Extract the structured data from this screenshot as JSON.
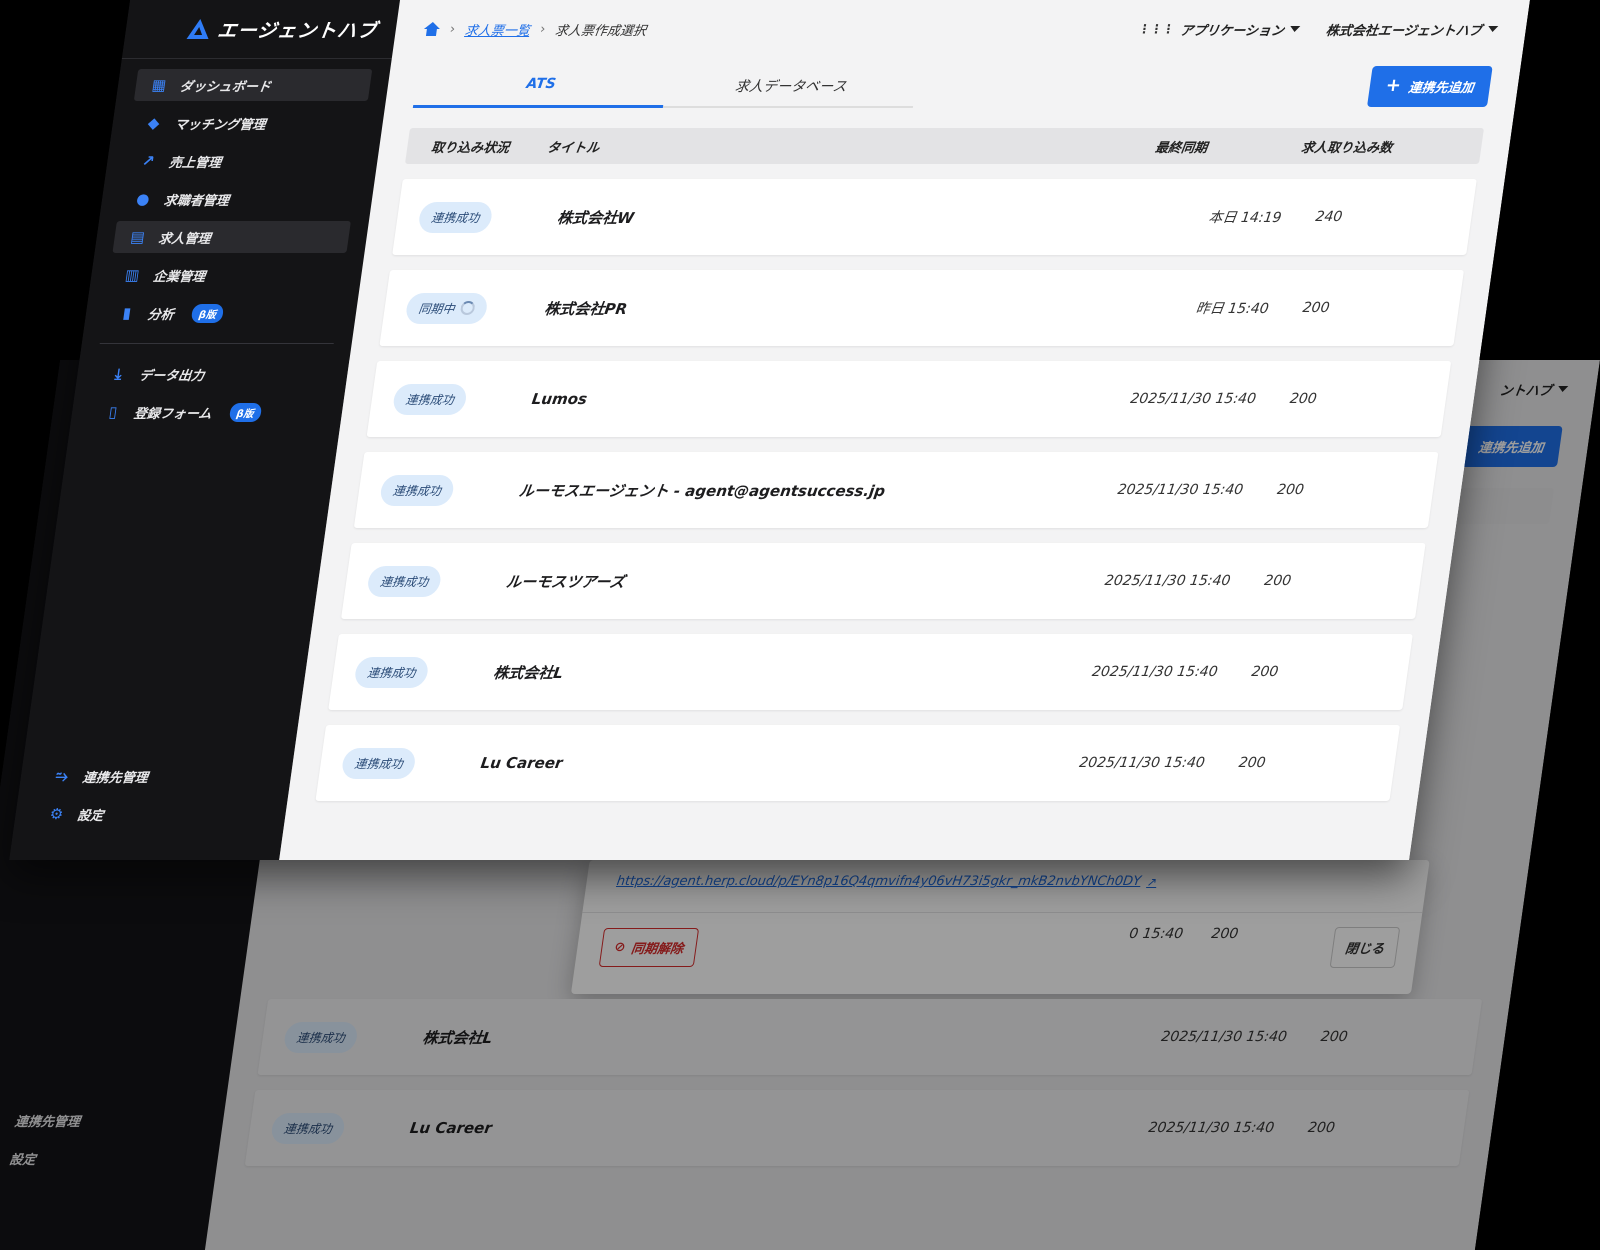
{
  "brand": {
    "name": "エージェントハブ",
    "accent": "#1f6fe8"
  },
  "sidebar": {
    "items": [
      {
        "label": "ダッシュボード",
        "icon": "dashboard-icon"
      },
      {
        "label": "マッチング管理",
        "icon": "diamond-icon"
      },
      {
        "label": "売上管理",
        "icon": "trend-icon"
      },
      {
        "label": "求職者管理",
        "icon": "person-icon"
      },
      {
        "label": "求人管理",
        "icon": "document-icon"
      },
      {
        "label": "企業管理",
        "icon": "building-icon"
      },
      {
        "label": "分析",
        "icon": "bar-chart-icon",
        "badge": "β版"
      }
    ],
    "secondary": [
      {
        "label": "データ出力",
        "icon": "download-icon"
      },
      {
        "label": "登録フォーム",
        "icon": "clipboard-icon",
        "badge": "β版"
      }
    ],
    "bottom": [
      {
        "label": "連携先管理",
        "icon": "link-icon"
      },
      {
        "label": "設定",
        "icon": "gear-icon"
      }
    ]
  },
  "breadcrumb": {
    "link": "求人票一覧",
    "current": "求人票作成選択"
  },
  "header": {
    "apps": "アプリケーション",
    "company": "株式会社エージェントハブ"
  },
  "tabs": [
    "ATS",
    "求人データベース"
  ],
  "add_button": "連携先追加",
  "table": {
    "headers": [
      "取り込み状況",
      "タイトル",
      "最終同期",
      "求人取り込み数"
    ],
    "rows": [
      {
        "status": "連携成功",
        "title": "株式会社W",
        "sync": "本日 14:19",
        "count": "240"
      },
      {
        "status": "同期中",
        "title": "株式会社PR",
        "sync": "昨日 15:40",
        "count": "200"
      },
      {
        "status": "連携成功",
        "title": "Lumos",
        "sync": "2025/11/30 15:40",
        "count": "200"
      },
      {
        "status": "連携成功",
        "title": "ルーモスエージェント - agent@agentsuccess.jp",
        "sync": "2025/11/30 15:40",
        "count": "200"
      },
      {
        "status": "連携成功",
        "title": "ルーモスツアーズ",
        "sync": "2025/11/30 15:40",
        "count": "200"
      },
      {
        "status": "連携成功",
        "title": "株式会社L",
        "sync": "2025/11/30 15:40",
        "count": "200"
      },
      {
        "status": "連携成功",
        "title": "Lu Career",
        "sync": "2025/11/30 15:40",
        "count": "200"
      }
    ]
  },
  "back_window": {
    "company_partial": "ントハブ",
    "add_partial": "連携先追加",
    "modal": {
      "url": "https://agent.herp.cloud/p/EYn8p16Q4qmvifn4y06vH73i5gkr_mkB2nvbYNCh0DY",
      "unsync": "同期解除",
      "close": "閉じる"
    },
    "partial_sync": "0 15:40",
    "partial_count": "200",
    "rows": [
      {
        "status": "連携成功",
        "title": "株式会社L",
        "sync": "2025/11/30 15:40",
        "count": "200"
      },
      {
        "status": "連携成功",
        "title": "Lu Career",
        "sync": "2025/11/30 15:40",
        "count": "200"
      }
    ]
  }
}
